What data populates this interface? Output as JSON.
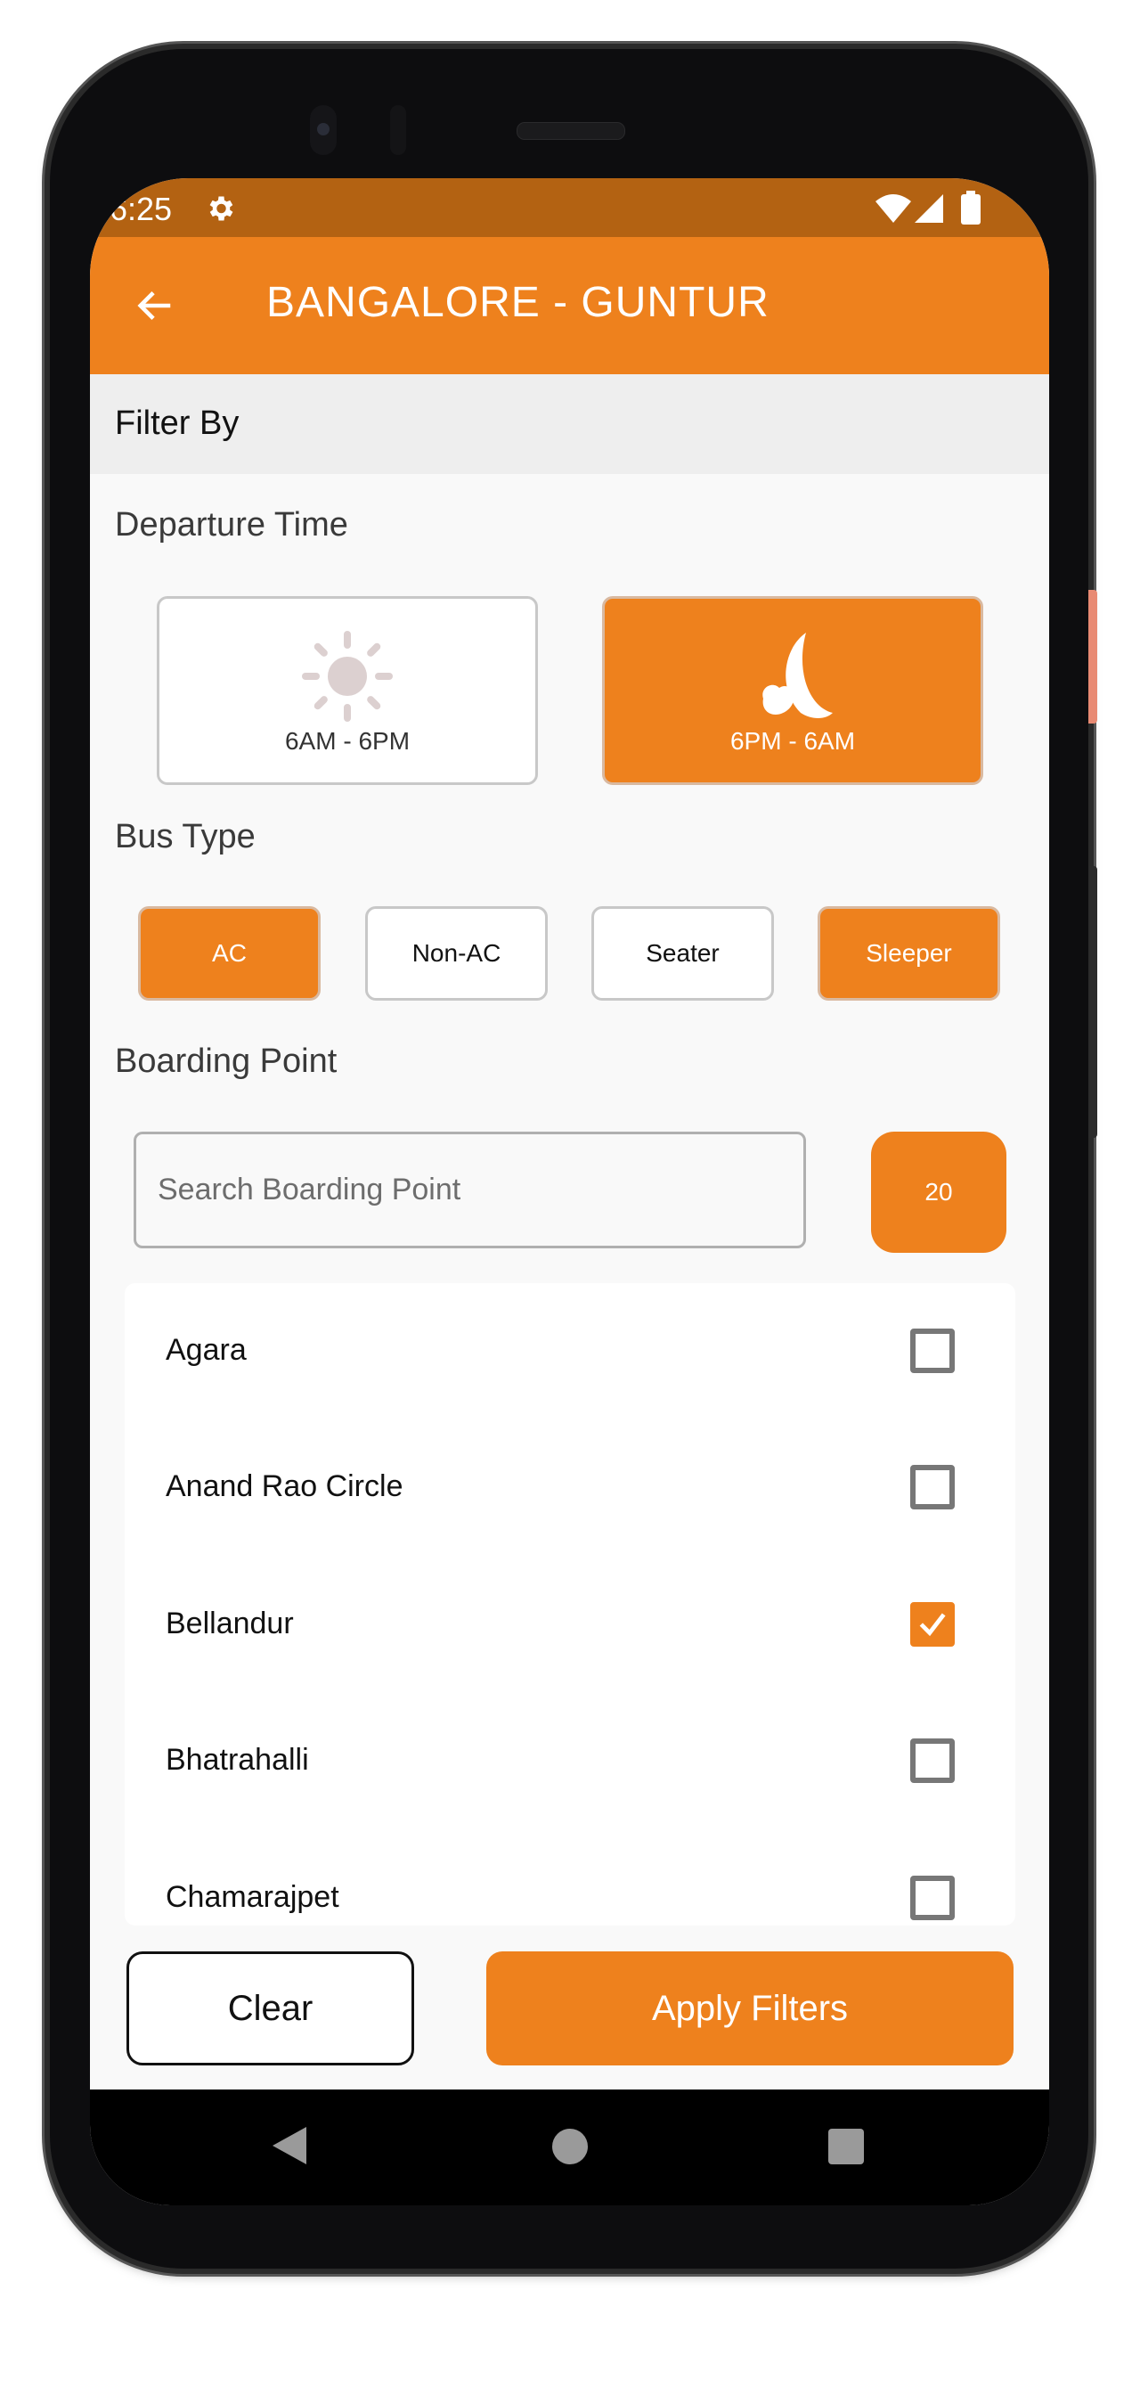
{
  "status_bar": {
    "time": "6:25",
    "icons": [
      "gear-icon",
      "wifi-icon",
      "signal-icon",
      "battery-icon"
    ]
  },
  "app_bar": {
    "back_icon": "arrow-left-icon",
    "title": "BANGALORE - GUNTUR"
  },
  "filter_header": "Filter By",
  "departure_time": {
    "title": "Departure Time",
    "options": [
      {
        "label": "6AM - 6PM",
        "icon": "sun-icon",
        "selected": false
      },
      {
        "label": "6PM - 6AM",
        "icon": "moon-icon",
        "selected": true
      }
    ]
  },
  "bus_type": {
    "title": "Bus Type",
    "options": [
      {
        "label": "AC",
        "selected": true
      },
      {
        "label": "Non-AC",
        "selected": false
      },
      {
        "label": "Seater",
        "selected": false
      },
      {
        "label": "Sleeper",
        "selected": true
      }
    ]
  },
  "boarding_point": {
    "title": "Boarding Point",
    "search_placeholder": "Search Boarding Point",
    "search_value": "",
    "count": "20",
    "items": [
      {
        "name": "Agara",
        "checked": false
      },
      {
        "name": "Anand Rao Circle",
        "checked": false
      },
      {
        "name": "Bellandur",
        "checked": true
      },
      {
        "name": "Bhatrahalli",
        "checked": false
      },
      {
        "name": "Chamarajpet",
        "checked": false
      }
    ]
  },
  "actions": {
    "clear_label": "Clear",
    "apply_label": "Apply Filters"
  },
  "nav_bar": {
    "icons": [
      "nav-back-icon",
      "nav-home-icon",
      "nav-recent-icon"
    ]
  },
  "colors": {
    "accent": "#ee811d",
    "status_bar": "#b36212",
    "sun_icon": "#dcd0d0"
  }
}
